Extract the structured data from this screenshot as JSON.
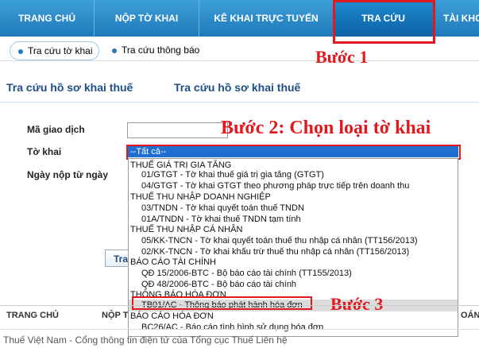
{
  "nav": {
    "items": [
      "TRANG CHỦ",
      "NỘP TỜ KHAI",
      "KÊ KHAI TRỰC TUYẾN",
      "TRA CỨU",
      "TÀI KHO"
    ]
  },
  "subtabs": [
    "Tra cứu tờ khai",
    "Tra cứu thông báo"
  ],
  "section_tabs": [
    "Tra cứu hồ sơ khai thuế",
    "Tra cứu hồ sơ khai thuế"
  ],
  "form": {
    "ma_giao_dich_label": "Mã giao dịch",
    "to_khai_label": "Tờ khai",
    "ngay_nop_label": "Ngày nộp từ ngày",
    "select_value": "--Tất cả--",
    "lookup_button": "Tra"
  },
  "dropdown": [
    {
      "type": "group",
      "text": "THUẾ GIÁ TRỊ GIA TĂNG"
    },
    {
      "type": "child",
      "text": "01/GTGT - Tờ khai thuế giá trị gia tăng (GTGT)"
    },
    {
      "type": "child",
      "text": "04/GTGT - Tờ khai GTGT theo phương pháp trực tiếp trên doanh thu"
    },
    {
      "type": "group",
      "text": "THUẾ THU NHẬP DOANH NGHIỆP"
    },
    {
      "type": "child",
      "text": "03/TNDN - Tờ khai quyết toán thuế TNDN"
    },
    {
      "type": "child",
      "text": "01A/TNDN - Tờ khai thuế TNDN tạm tính"
    },
    {
      "type": "group",
      "text": "THUẾ THU NHẬP CÁ NHÂN"
    },
    {
      "type": "child",
      "text": "05/KK-TNCN - Tờ khai quyết toán thuế thu nhập cá nhân (TT156/2013)"
    },
    {
      "type": "child",
      "text": "02/KK-TNCN - Tờ khai khấu trừ thuế thu nhập cá nhân (TT156/2013)"
    },
    {
      "type": "group",
      "text": "BÁO CÁO TÀI CHÍNH"
    },
    {
      "type": "child",
      "text": "QĐ 15/2006-BTC - Bộ báo cáo tài chính (TT155/2013)"
    },
    {
      "type": "child",
      "text": "QĐ 48/2006-BTC - Bộ báo cáo tài chính"
    },
    {
      "type": "group",
      "text": "THÔNG BÁO HÓA ĐƠN"
    },
    {
      "type": "child",
      "text": "TB01/AC - Thông báo phát hành hóa đơn",
      "selected": true
    },
    {
      "type": "group",
      "text": "BÁO CÁO HÓA ĐƠN"
    },
    {
      "type": "child",
      "text": "BC26/AC - Báo cáo tình hình sử dụng hóa đơn"
    }
  ],
  "steps": {
    "step1": "Bước 1",
    "step2": "Bước 2: Chọn loại tờ khai",
    "step3": "Bước 3"
  },
  "footer": {
    "nav_left": "TRANG CHỦ",
    "nav_mid": "NỘP T",
    "nav_right": "OÁN",
    "copyright": "Thuế Việt Nam - Cổng thông tin điện tử của Tổng cục Thuế Liên hệ"
  },
  "colors": {
    "nav_blue": "#1f79b8",
    "highlight_red": "#e0191f",
    "selected_blue": "#1f6fd1"
  }
}
